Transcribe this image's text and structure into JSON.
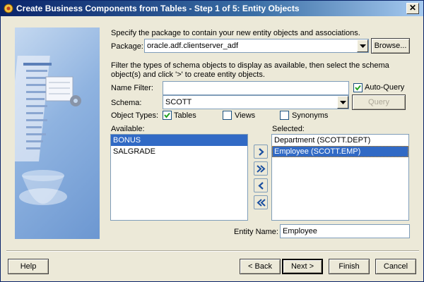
{
  "window": {
    "title": "Create Business Components from Tables - Step 1 of 5: Entity Objects"
  },
  "intro": {
    "package_prompt": "Specify the package to contain your new entity objects and associations.",
    "package_label": "Package:",
    "package_value": "oracle.adf.clientserver_adf",
    "browse_label": "Browse...",
    "filter_prompt_line1": "Filter the types of schema objects to display as available, then select the schema",
    "filter_prompt_line2": "object(s) and click '>' to create entity objects."
  },
  "filter": {
    "name_filter_label": "Name Filter:",
    "name_filter_value": "",
    "auto_query_label": "Auto-Query",
    "auto_query_checked": true,
    "schema_label": "Schema:",
    "schema_value": "SCOTT",
    "query_label": "Query",
    "object_types_label": "Object Types:",
    "tables_label": "Tables",
    "tables_checked": true,
    "views_label": "Views",
    "views_checked": false,
    "synonyms_label": "Synonyms",
    "synonyms_checked": false
  },
  "available": {
    "label": "Available:",
    "items": [
      "BONUS",
      "SALGRADE"
    ],
    "selected_index": 0
  },
  "selected": {
    "label": "Selected:",
    "items": [
      "Department (SCOTT.DEPT)",
      "Employee (SCOTT.EMP)"
    ],
    "selected_index": 1
  },
  "entity": {
    "label": "Entity Name:",
    "value": "Employee"
  },
  "footer": {
    "help": "Help",
    "back": "< Back",
    "next": "Next >",
    "finish": "Finish",
    "cancel": "Cancel"
  },
  "colors": {
    "title_start": "#0a246a",
    "selection": "#316ac5",
    "dialog_bg": "#ece9d8"
  }
}
